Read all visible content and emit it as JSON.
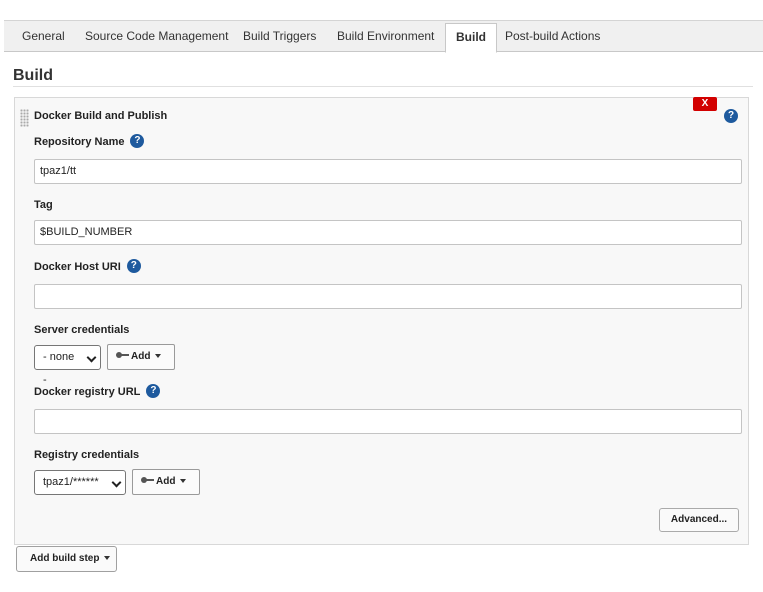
{
  "tabs": [
    {
      "label": "General"
    },
    {
      "label": "Source Code Management"
    },
    {
      "label": "Build Triggers"
    },
    {
      "label": "Build Environment"
    },
    {
      "label": "Build"
    },
    {
      "label": "Post-build Actions"
    }
  ],
  "active_tab": "Build",
  "section": {
    "title": "Build"
  },
  "step": {
    "title": "Docker Build and Publish",
    "delete_label": "X",
    "help_label": "?",
    "fields": {
      "repository_name": {
        "label": "Repository Name",
        "value": "tpaz1/tt"
      },
      "tag": {
        "label": "Tag",
        "value": "$BUILD_NUMBER"
      },
      "docker_host_uri": {
        "label": "Docker Host URI",
        "value": ""
      },
      "server_credentials": {
        "label": "Server credentials",
        "selected": "- none -",
        "add_label": "Add"
      },
      "docker_registry_url": {
        "label": "Docker registry URL",
        "value": ""
      },
      "registry_credentials": {
        "label": "Registry credentials",
        "selected": "tpaz1/******",
        "add_label": "Add"
      }
    },
    "advanced_label": "Advanced..."
  },
  "add_build_step_label": "Add build step",
  "colors": {
    "delete": "#d20000",
    "help": "#1e5a9e"
  },
  "icons": [
    "drag-handle-icon",
    "help-icon",
    "key-icon",
    "caret-down-icon",
    "chevron-down-icon"
  ]
}
